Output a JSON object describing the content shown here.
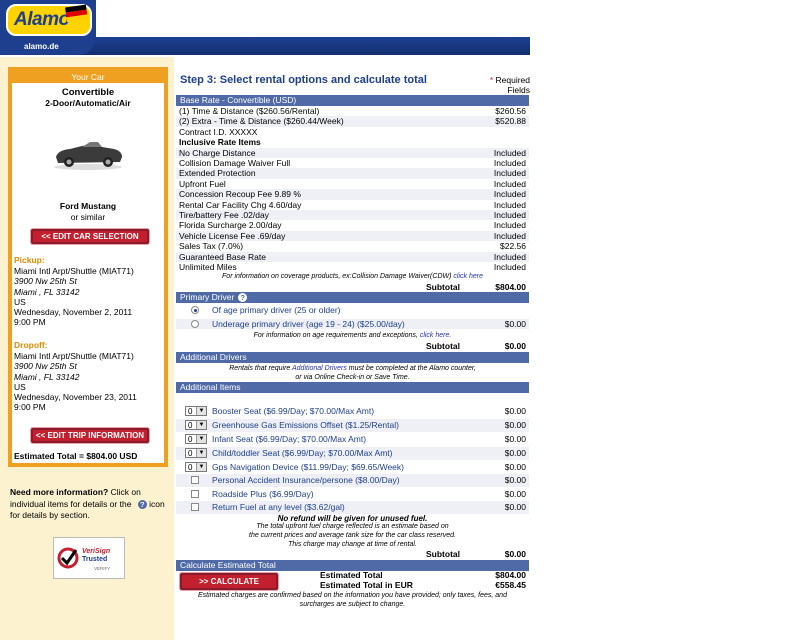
{
  "header": {
    "logo_text": "Alamo",
    "site": "alamo.de",
    "brand_color": "#1d3f8e",
    "logo_color": "#ffd300",
    "flag_colors": [
      "#000000",
      "#dd0000",
      "#ffce00"
    ]
  },
  "sidebar": {
    "your_car_title": "Your Car",
    "car_class": "Convertible",
    "car_desc": "2-Door/Automatic/Air",
    "car_model": "Ford Mustang",
    "or_similar": "or similar",
    "edit_car_button": "<< EDIT CAR SELECTION",
    "pickup_label": "Pickup:",
    "pickup": [
      "Miami Intl Arpt/Shuttle (MIAT71)",
      "3900 Nw 25th St",
      "Miami , FL 33142",
      "US",
      "Wednesday, November 2, 2011",
      "9:00 PM"
    ],
    "dropoff_label": "Dropoff:",
    "dropoff": [
      "Miami Intl Arpt/Shuttle (MIAT71)",
      "3900 Nw 25th St",
      "Miami , FL 33142",
      "US",
      "Wednesday, November 23, 2011",
      "9:00 PM"
    ],
    "edit_trip_button": "<< EDIT TRIP INFORMATION",
    "estimated_total": "Estimated Total = $804.00 USD",
    "need_info_bold": "Need more information?",
    "need_info_1": " Click on",
    "need_info_2": "individual items for details or the",
    "need_info_3": "icon",
    "need_info_4": "for details by section.",
    "verisign_line1": "VeriSign",
    "verisign_line2": "Trusted",
    "verisign_line3": "VERIFY"
  },
  "main": {
    "step_title": "Step 3:  Select rental options and calculate total",
    "required_star": "*",
    "required_1": "Required",
    "required_2": "Fields",
    "base_rate_header": "Base Rate - Convertible (USD)",
    "base_rows": [
      {
        "label": "(1) Time & Distance ($260.56/Rental)",
        "value": "$260.56"
      },
      {
        "label": "(2) Extra - Time & Distance ($260.44/Week)",
        "value": "$520.88"
      },
      {
        "label": "Contract I.D.  XXXXX",
        "value": ""
      }
    ],
    "inclusive_header": "Inclusive Rate Items",
    "inclusive_rows": [
      {
        "label": "No Charge Distance",
        "value": "Included"
      },
      {
        "label": "Collision Damage Waiver Full",
        "value": "Included"
      },
      {
        "label": "Extended Protection",
        "value": "Included"
      },
      {
        "label": "Upfront Fuel",
        "value": "Included"
      },
      {
        "label": "Concession Recoup Fee 9.89 %",
        "value": "Included"
      },
      {
        "label": "Rental Car Facility Chg 4.60/day",
        "value": "Included"
      },
      {
        "label": "Tire/battery Fee .02/day",
        "value": "Included"
      },
      {
        "label": "Florida Surcharge 2.00/day",
        "value": "Included"
      },
      {
        "label": "Vehicle License Fee .69/day",
        "value": "Included"
      },
      {
        "label": "Sales Tax (7.0%)",
        "value": "$22.56"
      },
      {
        "label": "Guaranteed Base Rate",
        "value": "Included"
      },
      {
        "label": "Unlimited Miles",
        "value": "Included"
      }
    ],
    "coverage_note": "For information on coverage products, ex:Collision Damage Waiver(CDW)",
    "click_here": "click here",
    "subtotal_label": "Subtotal",
    "base_subtotal": "$804.00",
    "primary_driver_header": "Primary Driver",
    "help_glyph": "?",
    "driver_options": [
      {
        "label": "Of age primary driver (25 or older)",
        "value": "",
        "checked": true
      },
      {
        "label": "Underage primary driver (age 19  - 24) ($25.00/day)",
        "value": "$0.00",
        "checked": false
      }
    ],
    "age_note": "For information on age requirements and exceptions,",
    "click_here_dot": "click here.",
    "driver_subtotal": "$0.00",
    "additional_drivers_header": "Additional Drivers",
    "add_drivers_note_1": "Rentals that require",
    "add_drivers_link": "Additional Drivers",
    "add_drivers_note_2": "must be completed at the Alamo counter,",
    "add_drivers_note_3": "or via Online Check-in or Save Time.",
    "additional_items_header": "Additional Items",
    "qty_items": [
      {
        "qty": "0",
        "label": "Booster Seat ($6.99/Day; $70.00/Max Amt)",
        "value": "$0.00"
      },
      {
        "qty": "0",
        "label": "Greenhouse Gas Emissions Offset ($1.25/Rental)",
        "value": "$0.00"
      },
      {
        "qty": "0",
        "label": "Infant Seat ($6.99/Day; $70.00/Max Amt)",
        "value": "$0.00"
      },
      {
        "qty": "0",
        "label": "Child/toddler Seat ($6.99/Day; $70.00/Max Amt)",
        "value": "$0.00"
      },
      {
        "qty": "0",
        "label": "Gps Navigation Device ($11.99/Day; $69.65/Week)",
        "value": "$0.00"
      }
    ],
    "check_items": [
      {
        "label": "Personal Accident Insurance/persone ($8.00/Day)",
        "value": "$0.00"
      },
      {
        "label": "Roadside Plus ($6.99/Day)",
        "value": "$0.00"
      },
      {
        "label": "Return Fuel at any level ($3.62/gal)",
        "value": "$0.00"
      }
    ],
    "refund_note": "No refund will be given for unused fuel.",
    "fuel_note_1": "The total upfront fuel charge reflected is an estimate based on",
    "fuel_note_2": "the current prices and average tank size for the car class reserved.",
    "fuel_note_3": "This charge may change at time of rental.",
    "items_subtotal": "$0.00",
    "calc_header": "Calculate Estimated Total",
    "calc_button": ">> CALCULATE",
    "est_total_label": "Estimated Total",
    "est_total_value": "$804.00",
    "est_eur_label": "Estimated Total in EUR",
    "est_eur_value": "€558.45",
    "footer_note_1": "Estimated charges are confirmed based on the information you have provided; only taxes, fees, and",
    "footer_note_2": "surcharges are subject to change."
  }
}
